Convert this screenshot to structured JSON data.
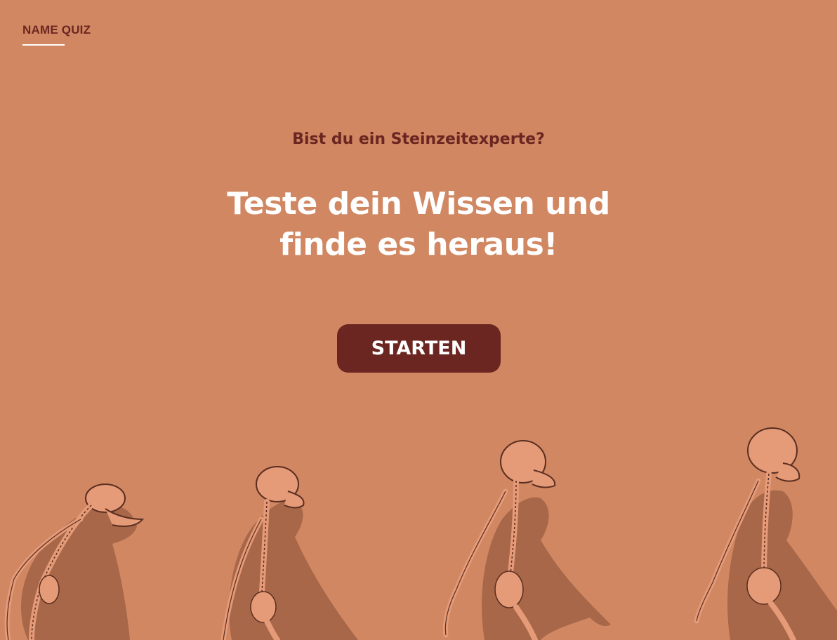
{
  "header": {
    "brand_label": "NAME QUIZ"
  },
  "hero": {
    "subtitle": "Bist du ein Steinzeitexperte?",
    "headline_line1": "Teste dein Wissen und",
    "headline_line2": "finde es heraus!"
  },
  "actions": {
    "start_label": "STARTEN"
  },
  "illustration": {
    "name": "human-evolution-skeletons",
    "stages": [
      "ape-skeleton",
      "australopithecus-skeleton",
      "homo-erectus-skeleton",
      "homo-sapiens-skeleton"
    ]
  },
  "colors": {
    "background": "#d08762",
    "accent": "#6b2621",
    "text_light": "#ffffff",
    "silhouette": "#a76748",
    "bone": "#e59a78",
    "bone_outline": "#5a2e20"
  }
}
